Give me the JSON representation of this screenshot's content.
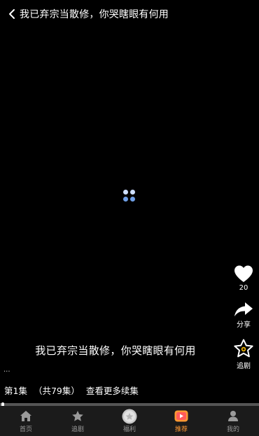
{
  "header": {
    "title": "我已弃宗当散修，你哭瞎眼有何用"
  },
  "player": {
    "subtitle": "我已弃宗当散修，你哭瞎眼有何用",
    "ellipsis": "...",
    "progress_fraction": 0.01
  },
  "rail": {
    "like_count": "20",
    "share_label": "分享",
    "follow_label": "追剧"
  },
  "episode": {
    "current": "第1集",
    "total": "（共79集）",
    "more": "查看更多续集"
  },
  "bottom_nav": {
    "items": [
      {
        "label": "首页",
        "icon": "home-icon"
      },
      {
        "label": "追剧",
        "icon": "star-icon"
      },
      {
        "label": "福利",
        "icon": "gift-icon"
      },
      {
        "label": "推荐",
        "icon": "play-icon",
        "active": true
      },
      {
        "label": "我的",
        "icon": "person-icon"
      }
    ]
  },
  "colors": {
    "background": "#000000",
    "accent": "#ff9933",
    "nav_bg": "#1b1b1b",
    "loading_dot": "#8ab4f8"
  }
}
